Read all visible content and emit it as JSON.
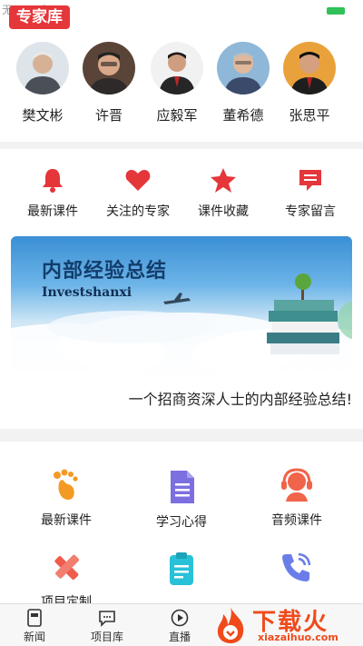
{
  "status": {
    "carrier": "无 SIM 卡"
  },
  "header": {
    "badge": "专家库"
  },
  "colors": {
    "accent": "#e5363a",
    "battery": "#2fc15a",
    "watermark": "#f04a1b"
  },
  "experts": [
    {
      "name": "樊文彬"
    },
    {
      "name": "许晋"
    },
    {
      "name": "应毅军"
    },
    {
      "name": "董希德"
    },
    {
      "name": "张思平"
    }
  ],
  "quick_actions": [
    {
      "label": "最新课件",
      "icon": "bell-icon"
    },
    {
      "label": "关注的专家",
      "icon": "heart-icon"
    },
    {
      "label": "课件收藏",
      "icon": "star-icon"
    },
    {
      "label": "专家留言",
      "icon": "message-icon"
    }
  ],
  "banner": {
    "title": "内部经验总结",
    "subtitle": "Investshanxi",
    "caption": "一个招商资深人士的内部经验总结!"
  },
  "features": [
    {
      "label": "最新课件",
      "icon": "footprint-icon"
    },
    {
      "label": "学习心得",
      "icon": "document-icon"
    },
    {
      "label": "音频课件",
      "icon": "headset-icon"
    },
    {
      "label": "项目定制",
      "icon": "pencil-ruler-icon"
    },
    {
      "label": "",
      "icon": "clipboard-icon"
    },
    {
      "label": "",
      "icon": "phone-call-icon"
    }
  ],
  "tabbar": [
    {
      "label": "新闻",
      "icon": "news-icon"
    },
    {
      "label": "项目库",
      "icon": "chat-icon"
    },
    {
      "label": "直播",
      "icon": "live-icon"
    }
  ],
  "watermark": {
    "text": "下载火",
    "domain": "xiazaihuo.com"
  }
}
